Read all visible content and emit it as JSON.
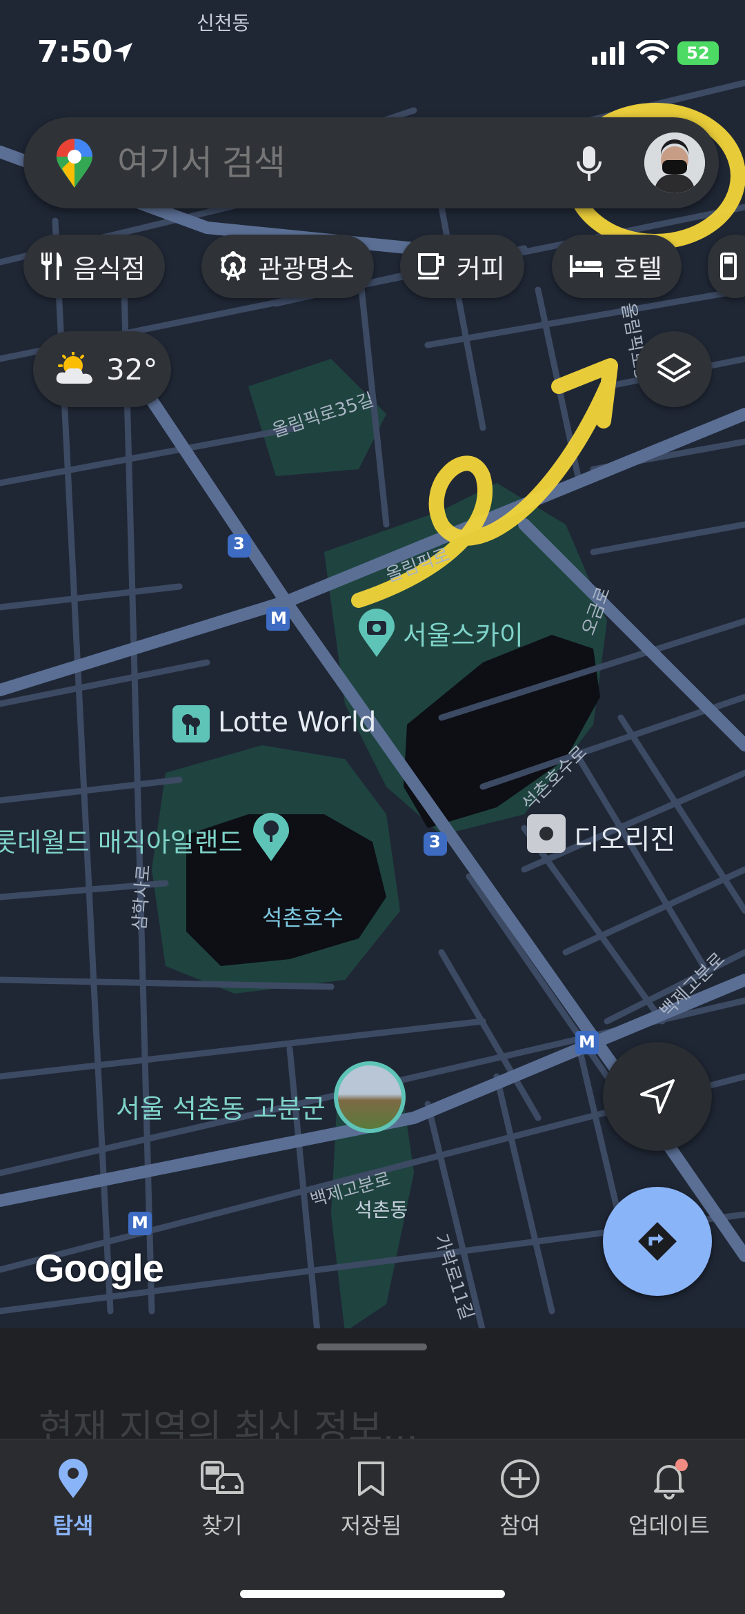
{
  "status_bar": {
    "time": "7:50",
    "battery": "52",
    "area_label": "신천동"
  },
  "search": {
    "placeholder": "여기서 검색"
  },
  "chips": [
    {
      "label": "음식점",
      "icon": "fork-knife-icon"
    },
    {
      "label": "관광명소",
      "icon": "ferris-wheel-icon"
    },
    {
      "label": "커피",
      "icon": "coffee-icon"
    },
    {
      "label": "호텔",
      "icon": "bed-icon"
    }
  ],
  "weather": {
    "temperature": "32°",
    "icon": "partly-sunny-icon"
  },
  "map": {
    "labels": {
      "seoul_sky": "서울스카이",
      "lotte_world": "Lotte World",
      "magic_island": "롯데월드 매직아일랜드",
      "seokchon_lake": "석촌호수",
      "dior": "디오리진",
      "burial_mounds": "서울 석촌동 고분군",
      "seokchon_dong": "석촌동"
    },
    "streets": {
      "olympic_35": "올림픽로35길",
      "olympic": "올림픽로",
      "ogeum": "오금로",
      "seokchon_hosu": "석촌호수로",
      "baekje_gobun": "백제고분로",
      "samhaksa": "삼학사로",
      "garak_11": "가락로11길",
      "olympic_side": "올림픽로3"
    },
    "route_badge": "3",
    "metro_badge": "M",
    "brand": "Google"
  },
  "sheet": {
    "title": "현재 지역의 최신 정보..."
  },
  "nav": [
    {
      "label": "탐색",
      "icon": "explore-pin-icon",
      "active": true
    },
    {
      "label": "찾기",
      "icon": "commute-icon",
      "active": false
    },
    {
      "label": "저장됨",
      "icon": "bookmark-icon",
      "active": false
    },
    {
      "label": "참여",
      "icon": "add-circle-icon",
      "active": false
    },
    {
      "label": "업데이트",
      "icon": "bell-icon",
      "active": false
    }
  ],
  "colors": {
    "map_bg": "#1f2735",
    "road": "#3d4a63",
    "major_road": "#5b6f95",
    "park": "#1f4440",
    "water": "#0d0f15",
    "accent": "#8ab4f8",
    "annotation": "#f2d43a"
  }
}
